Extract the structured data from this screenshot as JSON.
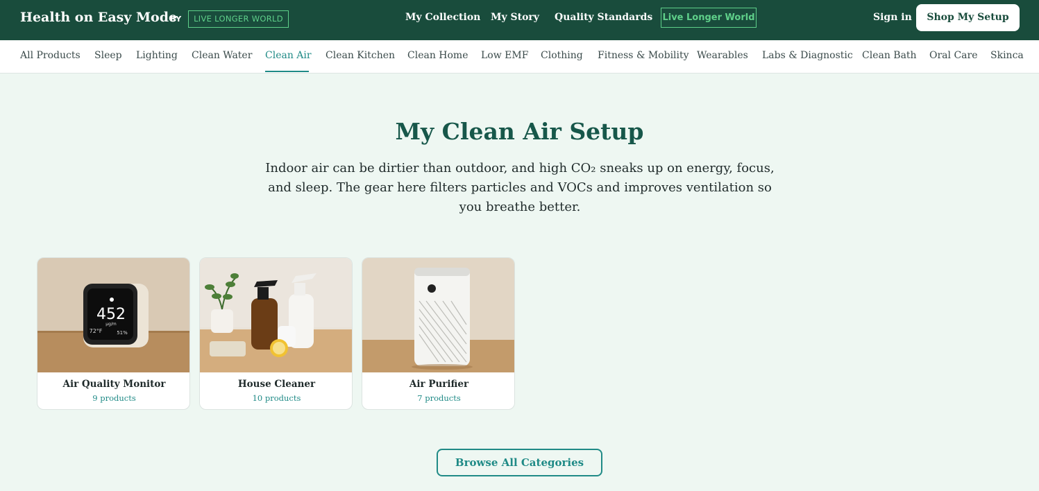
{
  "header": {
    "brand": "Health on Easy Mode",
    "by_label": "BY",
    "brand_badge": "LIVE LONGER WORLD",
    "nav": [
      "My Collection",
      "My Story",
      "Quality Standards"
    ],
    "nav_badge": "Live Longer World",
    "signin": "Sign in",
    "cta": "Shop My Setup"
  },
  "categories": {
    "items": [
      "All Products",
      "Sleep",
      "Lighting",
      "Clean Water",
      "Clean Air",
      "Clean Kitchen",
      "Clean Home",
      "Low EMF",
      "Clothing",
      "Fitness & Mobility",
      "Wearables",
      "Labs & Diagnostic",
      "Clean Bath",
      "Oral Care",
      "Skinca"
    ],
    "active": "Clean Air"
  },
  "hero": {
    "title": "My Clean Air Setup",
    "description": "Indoor air can be dirtier than outdoor, and high CO₂ sneaks up on energy, focus, and sleep. The gear here filters particles and VOCs and improves ventilation so you breathe better."
  },
  "cards": [
    {
      "title": "Air Quality Monitor",
      "count": "9 products",
      "image_icon": "air-quality-monitor-image",
      "display_value": "452",
      "display_unit": "µg/m",
      "display_temp": "72°F",
      "display_humidity": "51%"
    },
    {
      "title": "House Cleaner",
      "count": "10 products",
      "image_icon": "house-cleaner-image"
    },
    {
      "title": "Air Purifier",
      "count": "7 products",
      "image_icon": "air-purifier-image"
    }
  ],
  "browse_button": "Browse All Categories",
  "colors": {
    "header_bg": "#194c3c",
    "accent_green": "#5fd08a",
    "teal": "#1f8a86",
    "page_bg": "#eef7f2",
    "title_green": "#17574a"
  }
}
